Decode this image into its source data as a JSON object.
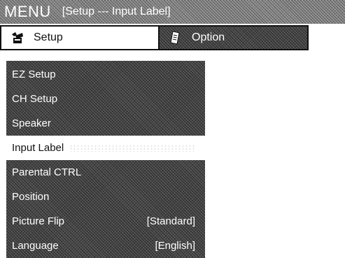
{
  "title_bar": {
    "menu_label": "MENU",
    "breadcrumb": "[Setup --- Input Label]"
  },
  "tabs": [
    {
      "label": "Setup",
      "icon": "toolbox-icon",
      "selected": true
    },
    {
      "label": "Option",
      "icon": "note-icon",
      "selected": false
    }
  ],
  "menu": {
    "items": [
      {
        "label": "EZ Setup",
        "value": ""
      },
      {
        "label": "CH Setup",
        "value": ""
      },
      {
        "label": "Speaker",
        "value": ""
      },
      {
        "label": "Input Label",
        "value": "",
        "selected": true
      },
      {
        "label": "Parental CTRL",
        "value": ""
      },
      {
        "label": "Position",
        "value": ""
      },
      {
        "label": "Picture Flip",
        "value": "[Standard]"
      },
      {
        "label": "Language",
        "value": "[English]"
      }
    ]
  },
  "colors": {
    "selected_bg": "#ffffff",
    "menu_bg": "#4a4a4a",
    "title_bg": "#8a8a8a"
  }
}
